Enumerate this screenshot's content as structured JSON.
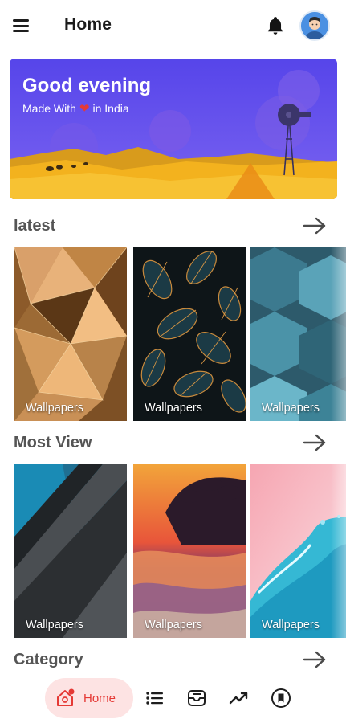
{
  "header": {
    "title": "Home",
    "menu_icon": "hamburger-menu-icon",
    "bell_icon": "bell-icon",
    "avatar": "user-avatar"
  },
  "banner": {
    "greeting": "Good evening",
    "made_with_prefix": "Made With",
    "heart": "❤",
    "made_with_suffix": "in India",
    "colors": {
      "sky": "#5b4ae8",
      "sand": "#f3b21e"
    }
  },
  "sections": {
    "latest": {
      "title": "latest",
      "cards": [
        {
          "label": "Wallpapers",
          "theme": "golden-geometric"
        },
        {
          "label": "Wallpapers",
          "theme": "dark-leaves"
        },
        {
          "label": "Wallpapers",
          "theme": "teal-hexagons"
        }
      ]
    },
    "most_view": {
      "title": "Most View",
      "cards": [
        {
          "label": "Wallpapers",
          "theme": "blue-grey-material"
        },
        {
          "label": "Wallpapers",
          "theme": "sunset-beach"
        },
        {
          "label": "Wallpapers",
          "theme": "pink-water-splash"
        }
      ]
    },
    "category": {
      "title": "Category"
    }
  },
  "bottom_nav": {
    "home_label": "Home",
    "items": [
      "home-icon",
      "list-icon",
      "inbox-icon",
      "trending-icon",
      "bookmark-icon"
    ],
    "accent": "#e53935"
  }
}
